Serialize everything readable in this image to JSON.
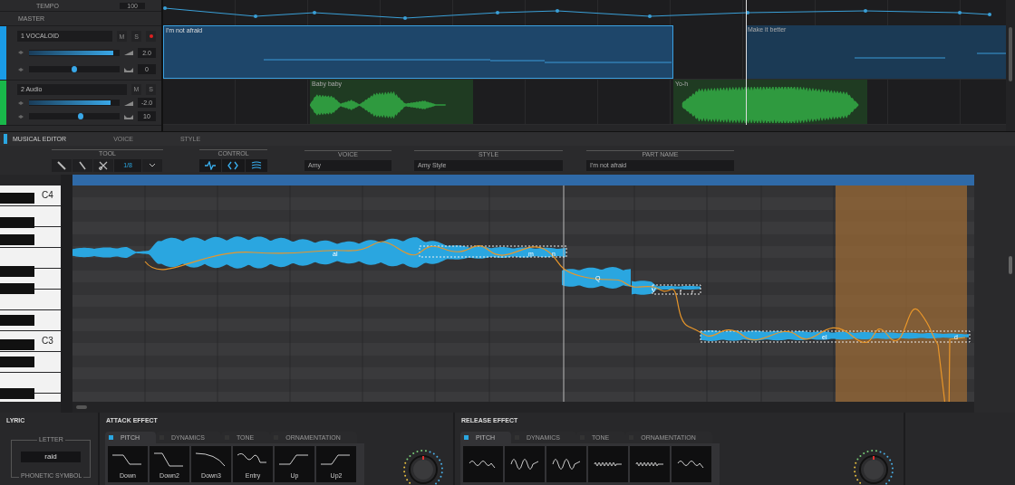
{
  "arrangement": {
    "tempo_label": "TEMPO",
    "tempo_value": "100",
    "master_label": "MASTER",
    "tracks": [
      {
        "kind": "vocaloid",
        "name": "1 VOCALOID",
        "color": "#1a9be6",
        "mute": "M",
        "solo": "S",
        "record_armed": true,
        "volume": {
          "level": 0.93,
          "value": "2.0"
        },
        "pan": {
          "level": 0.5,
          "value": "0"
        },
        "parts": [
          {
            "title": "I'm not afraid",
            "selected": true
          },
          {
            "title": "Make it better",
            "selected": false
          }
        ]
      },
      {
        "kind": "audio",
        "name": "2 Audio",
        "color": "#19b84a",
        "mute": "M",
        "solo": "S",
        "record_armed": false,
        "volume": {
          "level": 0.9,
          "value": "-2.0"
        },
        "pan": {
          "level": 0.57,
          "value": "10"
        },
        "parts": [
          {
            "title": "Baby baby",
            "selected": false
          },
          {
            "title": "Yo-h",
            "selected": false
          }
        ]
      }
    ]
  },
  "editor_tabs": [
    {
      "label": "MUSICAL EDITOR",
      "selected": true
    },
    {
      "label": "VOICE",
      "selected": false
    },
    {
      "label": "STYLE",
      "selected": false
    }
  ],
  "toolbar": {
    "tool_label": "TOOL",
    "quantize": "1/8",
    "control_label": "CONTROL",
    "voice_label": "VOICE",
    "voice": "Amy",
    "style_label": "STYLE",
    "style": "Amy Style",
    "part_name_label": "PART NAME",
    "part_name": "I'm not afraid"
  },
  "piano_roll": {
    "keys": [
      "C4",
      "C3"
    ],
    "phonemes": [
      "al",
      "m",
      "n",
      "Q",
      "V",
      "f",
      "r",
      "el",
      "d"
    ]
  },
  "lyric": {
    "title": "LYRIC",
    "letter_label": "LETTER",
    "letter": "raid",
    "phonetic_label": "PHONETIC SYMBOL"
  },
  "attack_effect": {
    "title": "ATTACK EFFECT",
    "tabs": [
      {
        "label": "PITCH",
        "selected": true
      },
      {
        "label": "DYNAMICS",
        "selected": false
      },
      {
        "label": "TONE",
        "selected": false
      },
      {
        "label": "ORNAMENTATION",
        "selected": false
      }
    ],
    "presets": [
      "Down",
      "Down2",
      "Down3",
      "Entry",
      "Up",
      "Up2"
    ]
  },
  "release_effect": {
    "title": "RELEASE EFFECT",
    "tabs": [
      {
        "label": "PITCH",
        "selected": true
      },
      {
        "label": "DYNAMICS",
        "selected": false
      },
      {
        "label": "TONE",
        "selected": false
      },
      {
        "label": "ORNAMENTATION",
        "selected": false
      }
    ]
  }
}
